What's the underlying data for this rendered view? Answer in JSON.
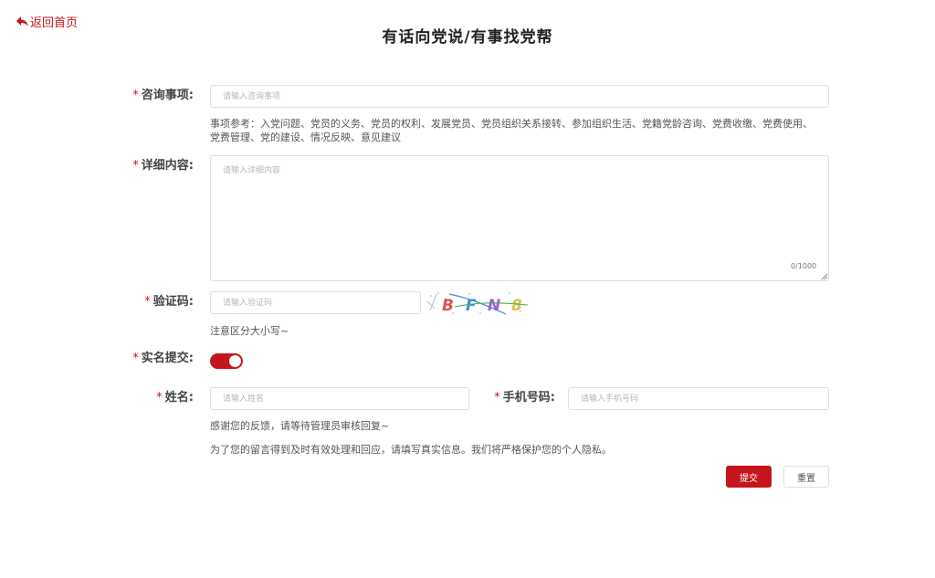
{
  "header": {
    "back_label": "返回首页",
    "title": "有话向党说/有事找党帮"
  },
  "form": {
    "topic": {
      "label": "咨询事项:",
      "placeholder": "请输入咨询事项",
      "hint": "事项参考：入党问题、党员的义务、党员的权利、发展党员、党员组织关系接转、参加组织生活、党籍党龄咨询、党费收缴、党费使用、党费管理、党的建设、情况反映、意见建议"
    },
    "detail": {
      "label": "详细内容:",
      "placeholder": "请输入详细内容",
      "counter": "0/1000"
    },
    "captcha": {
      "label": "验证码:",
      "placeholder": "请输入验证码",
      "chars": [
        "B",
        "F",
        "N",
        "8"
      ],
      "char_colors": [
        "#d9534f",
        "#3b8fd9",
        "#b055d6",
        "#e0c23a"
      ],
      "hint": "注意区分大小写~"
    },
    "realname": {
      "label": "实名提交:",
      "enabled": true
    },
    "name": {
      "label": "姓名:",
      "placeholder": "请输入姓名"
    },
    "phone": {
      "label": "手机号码:",
      "placeholder": "请输入手机号码"
    },
    "feedback_hint": "感谢您的反馈，请等待管理员审核回复~",
    "privacy_hint": "为了您的留言得到及时有效处理和回应，请填写真实信息。我们将严格保护您的个人隐私。",
    "submit_label": "提交",
    "reset_label": "重置"
  },
  "colors": {
    "accent": "#c4161c",
    "border": "#dcdfe6"
  }
}
